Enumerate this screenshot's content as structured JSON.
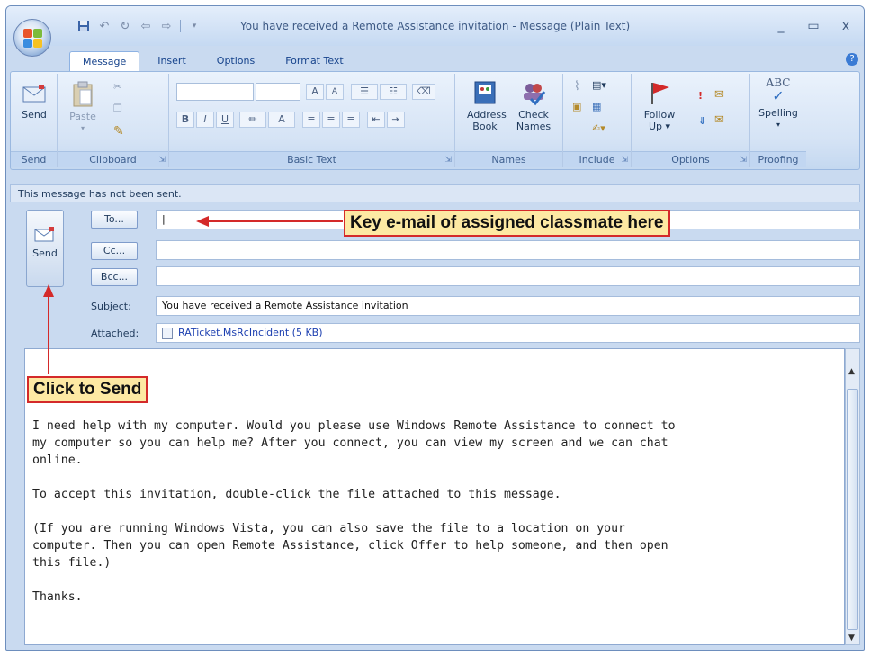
{
  "window": {
    "title": "You have received a Remote Assistance invitation - Message (Plain Text)",
    "controls": [
      "_",
      "▭",
      "x"
    ]
  },
  "tabs": [
    "Message",
    "Insert",
    "Options",
    "Format Text"
  ],
  "ribbon": {
    "send_label": "Send",
    "paste_label": "Paste",
    "address_book": "Address Book",
    "check_names": "Check Names",
    "follow_up": "Follow Up ▾",
    "spelling": "Spelling",
    "spelling_abc": "ABC",
    "groups": [
      "Send",
      "Clipboard",
      "Basic Text",
      "Names",
      "Include",
      "Options",
      "Proofing"
    ],
    "font_buttons": [
      "B",
      "I",
      "U"
    ]
  },
  "message": {
    "info": "This message has not been sent.",
    "send_label": "Send",
    "to_btn": "To...",
    "cc_btn": "Cc...",
    "bcc_btn": "Bcc...",
    "to_value": "|",
    "subject_label": "Subject:",
    "subject_value": "You have received a Remote Assistance invitation",
    "attached_label": "Attached:",
    "attachment": "RATicket.MsRcIncident (5 KB)",
    "body": "\n\n\n\nI need help with my computer. Would you please use Windows Remote Assistance to connect to\nmy computer so you can help me? After you connect, you can view my screen and we can chat\nonline.\n\nTo accept this invitation, double-click the file attached to this message.\n\n(If you are running Windows Vista, you can also save the file to a location on your\ncomputer. Then you can open Remote Assistance, click Offer to help someone, and then open\nthis file.)\n\nThanks."
  },
  "callouts": {
    "email": "Key e-mail of assigned classmate here",
    "send": "Click to Send"
  },
  "colors": {
    "callout_bg": "#fde9a3",
    "callout_border": "#d42a2a",
    "ribbon_bg": "#d5e3f5"
  }
}
